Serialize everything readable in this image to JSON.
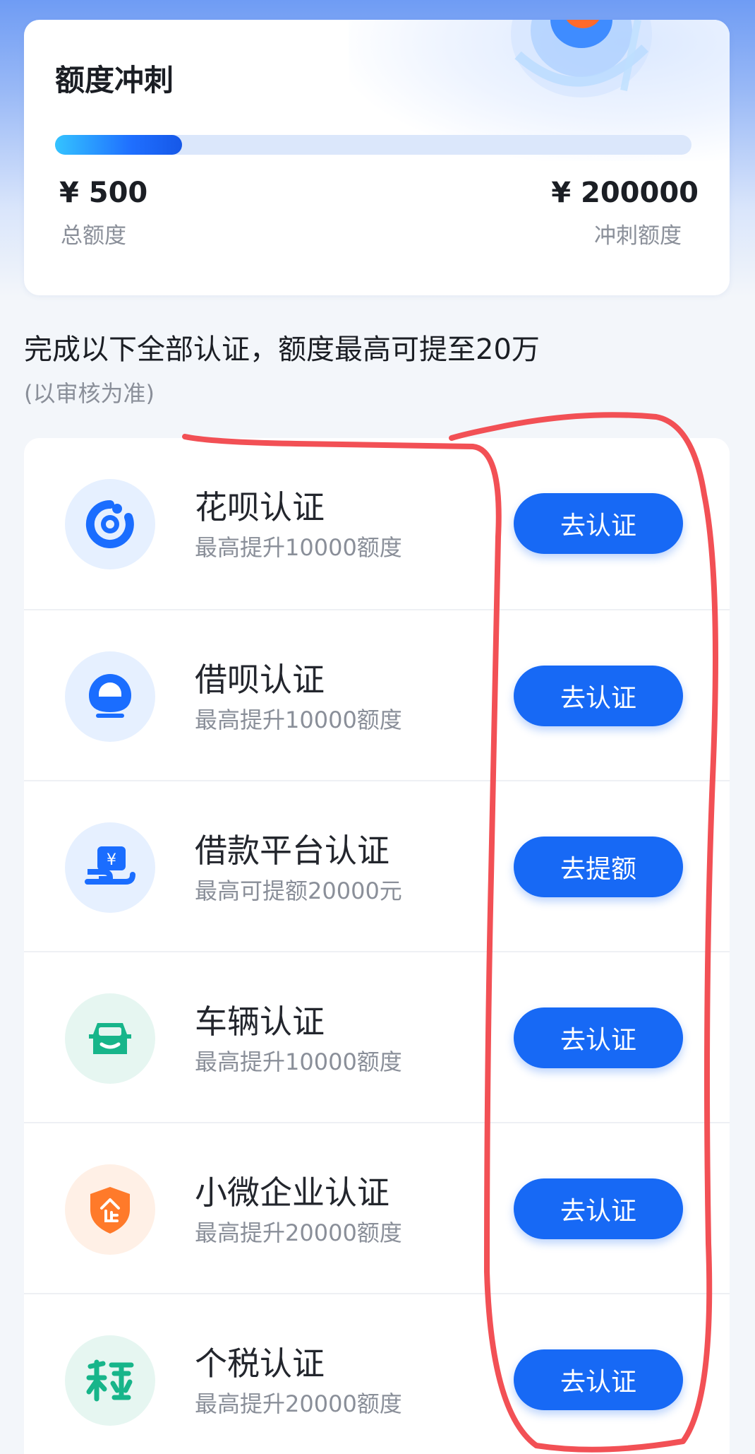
{
  "colors": {
    "primary": "#1769f5",
    "annotation": "#f25055",
    "icon_blue_bg": "#e6f0ff",
    "icon_green_bg": "#e6f6f1",
    "icon_orange_bg": "#fff0e6"
  },
  "quota": {
    "title": "额度冲刺",
    "progress_fraction": 0.2,
    "left_amount": "¥ 500",
    "left_label": "总额度",
    "right_amount": "¥ 200000",
    "right_label": "冲刺额度"
  },
  "headline": "完成以下全部认证，额度最高可提至20万",
  "note": "(以审核为准)",
  "items": [
    {
      "icon": "huabei-icon",
      "title": "花呗认证",
      "subtitle": "最高提升10000额度",
      "button": "去认证"
    },
    {
      "icon": "jiebei-icon",
      "title": "借呗认证",
      "subtitle": "最高提升10000额度",
      "button": "去认证"
    },
    {
      "icon": "loan-platform-icon",
      "title": "借款平台认证",
      "subtitle": "最高可提额20000元",
      "button": "去提额"
    },
    {
      "icon": "car-icon",
      "title": "车辆认证",
      "subtitle": "最高提升10000额度",
      "button": "去认证"
    },
    {
      "icon": "enterprise-shield-icon",
      "title": "小微企业认证",
      "subtitle": "最高提升20000额度",
      "button": "去认证"
    },
    {
      "icon": "tax-icon",
      "title": "个税认证",
      "subtitle": "最高提升20000额度",
      "button": "去认证"
    }
  ]
}
